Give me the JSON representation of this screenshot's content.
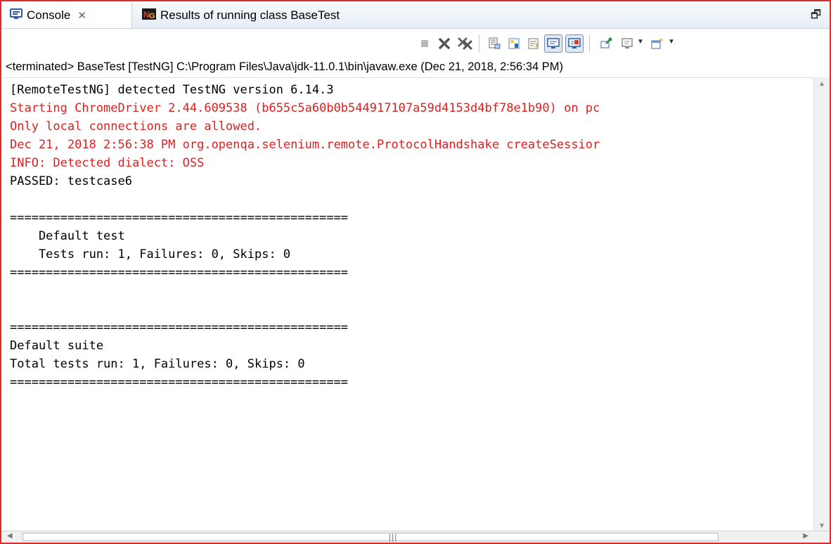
{
  "tabs": [
    {
      "label": "Console",
      "icon": "console-icon",
      "active": true
    },
    {
      "label": "Results of running class BaseTest",
      "icon": "testng-icon",
      "active": false
    }
  ],
  "window": {
    "restore_icon": "restore-icon"
  },
  "toolbar": {
    "icons": [
      "terminate-icon",
      "remove-launch-icon",
      "remove-all-terminated-icon",
      "clear-console-icon",
      "scroll-lock-icon",
      "word-wrap-icon",
      "show-console-stdout-icon",
      "show-console-stderr-icon",
      "pin-console-icon",
      "display-selected-console-icon",
      "open-console-icon"
    ]
  },
  "status_line": "<terminated> BaseTest [TestNG] C:\\Program Files\\Java\\jdk-11.0.1\\bin\\javaw.exe (Dec 21, 2018, 2:56:34 PM)",
  "colors": {
    "stdout": "#000000",
    "stderr": "#e01e1e",
    "border": "#d62f2f"
  },
  "console": {
    "lines": [
      {
        "text": "[RemoteTestNG] detected TestNG version 6.14.3",
        "stream": "stdout"
      },
      {
        "text": "Starting ChromeDriver 2.44.609538 (b655c5a60b0b544917107a59d4153d4bf78e1b90) on pc",
        "stream": "stderr"
      },
      {
        "text": "Only local connections are allowed.",
        "stream": "stderr"
      },
      {
        "text": "Dec 21, 2018 2:56:38 PM org.openqa.selenium.remote.ProtocolHandshake createSessior",
        "stream": "stderr"
      },
      {
        "text": "INFO: Detected dialect: OSS",
        "stream": "stderr"
      },
      {
        "text": "PASSED: testcase6",
        "stream": "stdout"
      },
      {
        "text": "",
        "stream": "stdout"
      },
      {
        "text": "===============================================",
        "stream": "stdout"
      },
      {
        "text": "    Default test",
        "stream": "stdout"
      },
      {
        "text": "    Tests run: 1, Failures: 0, Skips: 0",
        "stream": "stdout"
      },
      {
        "text": "===============================================",
        "stream": "stdout"
      },
      {
        "text": "",
        "stream": "stdout"
      },
      {
        "text": "",
        "stream": "stdout"
      },
      {
        "text": "===============================================",
        "stream": "stdout"
      },
      {
        "text": "Default suite",
        "stream": "stdout"
      },
      {
        "text": "Total tests run: 1, Failures: 0, Skips: 0",
        "stream": "stdout"
      },
      {
        "text": "===============================================",
        "stream": "stdout"
      }
    ]
  }
}
